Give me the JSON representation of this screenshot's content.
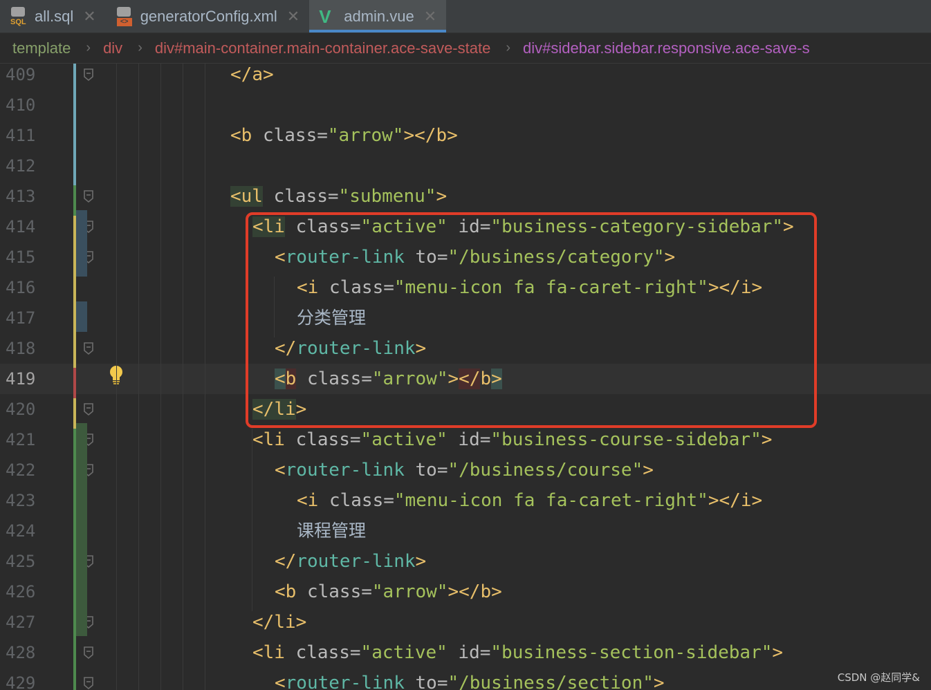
{
  "tabs": [
    {
      "label": "all.sql",
      "icon": "sql-file-icon",
      "active": false
    },
    {
      "label": "generatorConfig.xml",
      "icon": "xml-file-icon",
      "active": false
    },
    {
      "label": "admin.vue",
      "icon": "vue-file-icon",
      "active": true
    }
  ],
  "breadcrumb": [
    "template",
    "div",
    "div#main-container.main-container.ace-save-state",
    "div#sidebar.sidebar.responsive.ace-save-s"
  ],
  "current_line": 419,
  "lines": [
    {
      "num": "409",
      "text": "</a>"
    },
    {
      "num": "410",
      "text": ""
    },
    {
      "num": "411",
      "text": "<b class=\"arrow\"></b>"
    },
    {
      "num": "412",
      "text": ""
    },
    {
      "num": "413",
      "text": "<ul class=\"submenu\">"
    },
    {
      "num": "414",
      "text": "<li class=\"active\" id=\"business-category-sidebar\">"
    },
    {
      "num": "415",
      "text": "<router-link to=\"/business/category\">"
    },
    {
      "num": "416",
      "text": "<i class=\"menu-icon fa fa-caret-right\"></i>"
    },
    {
      "num": "417",
      "text": "分类管理"
    },
    {
      "num": "418",
      "text": "</router-link>"
    },
    {
      "num": "419",
      "text": "<b class=\"arrow\"></b>"
    },
    {
      "num": "420",
      "text": "</li>"
    },
    {
      "num": "421",
      "text": "<li class=\"active\" id=\"business-course-sidebar\">"
    },
    {
      "num": "422",
      "text": "<router-link to=\"/business/course\">"
    },
    {
      "num": "423",
      "text": "<i class=\"menu-icon fa fa-caret-right\"></i>"
    },
    {
      "num": "424",
      "text": "课程管理"
    },
    {
      "num": "425",
      "text": "</router-link>"
    },
    {
      "num": "426",
      "text": "<b class=\"arrow\"></b>"
    },
    {
      "num": "427",
      "text": "</li>"
    },
    {
      "num": "428",
      "text": "<li class=\"active\" id=\"business-section-sidebar\">"
    },
    {
      "num": "429",
      "text": "<router-link to=\"/business/section\">"
    }
  ],
  "watermark": "CSDN @赵同学&",
  "colors": {
    "background": "#2b2b2b",
    "tag": "#e8bf6a",
    "string": "#a5c25c",
    "highlight_box": "#e03c28",
    "tab_underline": "#4a88c7"
  }
}
